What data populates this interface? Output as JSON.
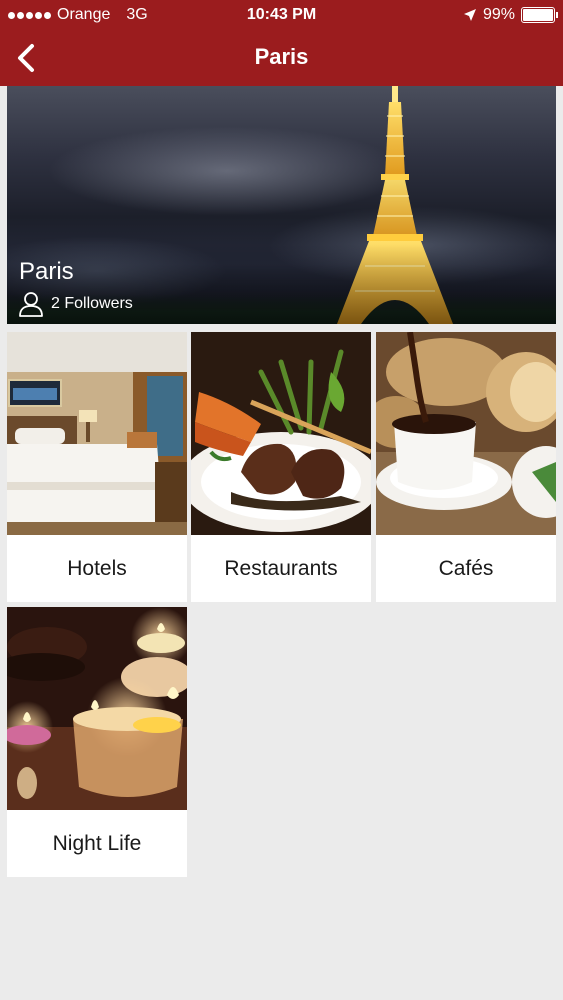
{
  "status_bar": {
    "carrier": "Orange",
    "network": "3G",
    "time": "10:43 PM",
    "battery": "99%",
    "battery_level": 0.99
  },
  "nav": {
    "title": "Paris",
    "back_icon": "chevron-left-icon"
  },
  "hero": {
    "city": "Paris",
    "followers": "2 Followers",
    "followers_icon": "person-icon"
  },
  "categories": [
    {
      "label": "Hotels"
    },
    {
      "label": "Restaurants"
    },
    {
      "label": "Cafés"
    },
    {
      "label": "Night Life"
    }
  ],
  "colors": {
    "header": "#9b1c1e",
    "background": "#ebebeb",
    "tile": "#ffffff"
  }
}
